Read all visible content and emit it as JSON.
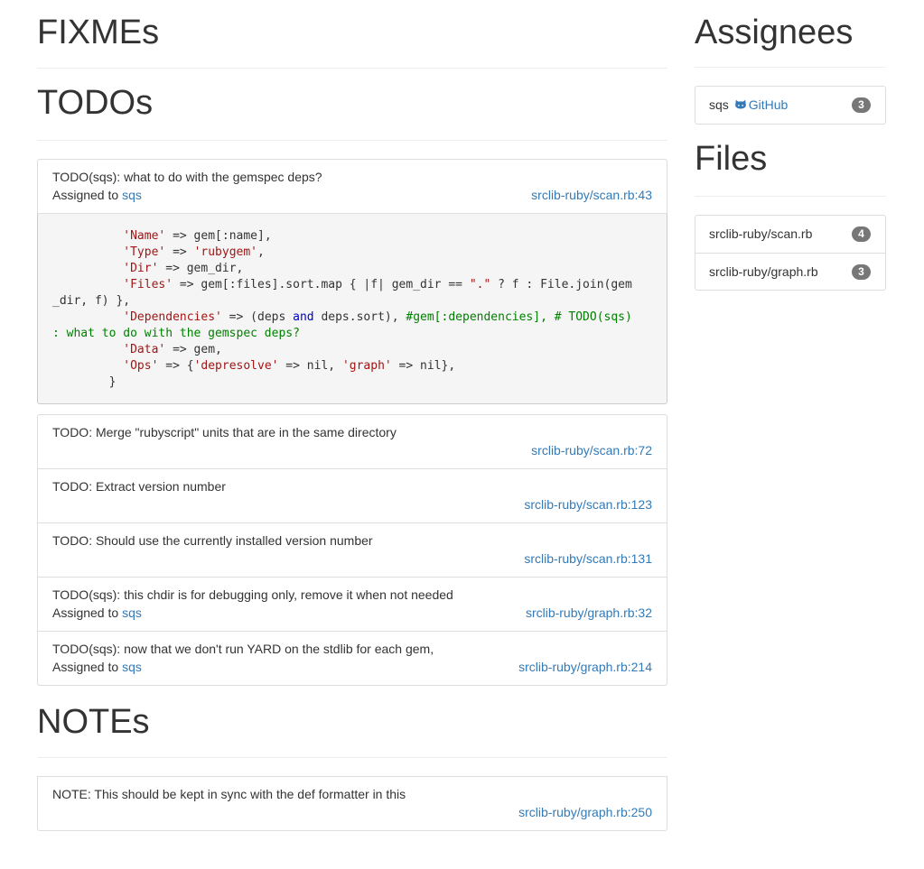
{
  "sections": {
    "fixmes_title": "FIXMEs",
    "todos_title": "TODOs",
    "notes_title": "NOTEs",
    "assignees_title": "Assignees",
    "files_title": "Files"
  },
  "first_todo": {
    "text": "TODO(sqs): what to do with the gemspec deps?",
    "assigned_prefix": "Assigned to",
    "assignee": "sqs",
    "file": "srclib-ruby/scan.rb:43",
    "code": [
      [
        {
          "t": "          "
        },
        {
          "t": "'Name'",
          "c": "str"
        },
        {
          "t": " => gem[:name],"
        }
      ],
      [
        {
          "t": "          "
        },
        {
          "t": "'Type'",
          "c": "str"
        },
        {
          "t": " => "
        },
        {
          "t": "'rubygem'",
          "c": "str"
        },
        {
          "t": ","
        }
      ],
      [
        {
          "t": "          "
        },
        {
          "t": "'Dir'",
          "c": "str"
        },
        {
          "t": " => gem_dir,"
        }
      ],
      [
        {
          "t": "          "
        },
        {
          "t": "'Files'",
          "c": "str"
        },
        {
          "t": " => gem[:files].sort.map { |f| gem_dir == "
        },
        {
          "t": "\".\"",
          "c": "str"
        },
        {
          "t": " ? f : File.join(gem"
        }
      ],
      [
        {
          "t": "_dir, f) },"
        }
      ],
      [
        {
          "t": "          "
        },
        {
          "t": "'Dependencies'",
          "c": "str"
        },
        {
          "t": " => (deps "
        },
        {
          "t": "and",
          "c": "kw"
        },
        {
          "t": " deps.sort), "
        },
        {
          "t": "#gem[:dependencies], # TODO(sqs)",
          "c": "cm"
        }
      ],
      [
        {
          "t": ": what to do with the gemspec deps?",
          "c": "cm"
        }
      ],
      [
        {
          "t": "          "
        },
        {
          "t": "'Data'",
          "c": "str"
        },
        {
          "t": " => gem,"
        }
      ],
      [
        {
          "t": "          "
        },
        {
          "t": "'Ops'",
          "c": "str"
        },
        {
          "t": " => {"
        },
        {
          "t": "'depresolve'",
          "c": "str"
        },
        {
          "t": " => nil, "
        },
        {
          "t": "'graph'",
          "c": "str"
        },
        {
          "t": " => nil},"
        }
      ],
      [
        {
          "t": "        }"
        }
      ]
    ]
  },
  "todos": [
    {
      "text": "TODO: Merge \"rubyscript\" units that are in the same directory",
      "assigned": null,
      "file": "srclib-ruby/scan.rb:72"
    },
    {
      "text": "TODO: Extract version number",
      "assigned": null,
      "file": "srclib-ruby/scan.rb:123"
    },
    {
      "text": "TODO: Should use the currently installed version number",
      "assigned": null,
      "file": "srclib-ruby/scan.rb:131"
    },
    {
      "text": "TODO(sqs): this chdir is for debugging only, remove it when not needed",
      "assigned": "sqs",
      "file": "srclib-ruby/graph.rb:32"
    },
    {
      "text": "TODO(sqs): now that we don't run YARD on the stdlib for each gem,",
      "assigned": "sqs",
      "file": "srclib-ruby/graph.rb:214"
    }
  ],
  "notes": [
    {
      "text": "NOTE: This should be kept in sync with the def formatter in this",
      "file": "srclib-ruby/graph.rb:250"
    }
  ],
  "assignees": [
    {
      "name": "sqs",
      "link": "GitHub",
      "icon": "github-icon",
      "count": "3"
    }
  ],
  "files": [
    {
      "name": "srclib-ruby/scan.rb",
      "count": "4"
    },
    {
      "name": "srclib-ruby/graph.rb",
      "count": "3"
    }
  ]
}
